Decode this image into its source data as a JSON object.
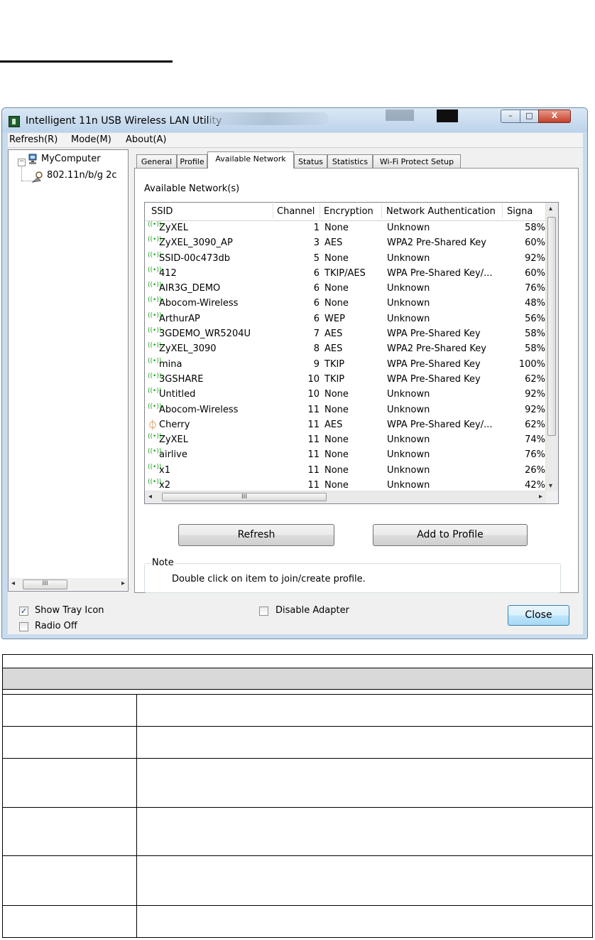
{
  "window": {
    "title": "Intelligent 11n USB Wireless LAN Utility",
    "caption_buttons": {
      "minimize": "–",
      "maximize": "□",
      "close": "X"
    }
  },
  "menu": {
    "refresh": "Refresh(R)",
    "mode": "Mode(M)",
    "about": "About(A)"
  },
  "tree": {
    "root": "MyComputer",
    "child": "802.11n/b/g 2c",
    "scroll_thumb": "III"
  },
  "tabs": [
    "General",
    "Profile",
    "Available Network",
    "Status",
    "Statistics",
    "Wi-Fi Protect Setup"
  ],
  "available_label": "Available Network(s)",
  "columns": {
    "ssid": "SSID",
    "channel": "Channel",
    "encryption": "Encryption",
    "auth": "Network Authentication",
    "signal": "Signa"
  },
  "networks": [
    {
      "ssid": "ZyXEL",
      "channel": "1",
      "encryption": "None",
      "auth": "Unknown",
      "signal": "58%",
      "icon": "wifi-signal-icon"
    },
    {
      "ssid": "ZyXEL_3090_AP",
      "channel": "3",
      "encryption": "AES",
      "auth": "WPA2 Pre-Shared Key",
      "signal": "60%",
      "icon": "wifi-signal-icon"
    },
    {
      "ssid": "SSID-00c473db",
      "channel": "5",
      "encryption": "None",
      "auth": "Unknown",
      "signal": "92%",
      "icon": "wifi-signal-icon"
    },
    {
      "ssid": "412",
      "channel": "6",
      "encryption": "TKIP/AES",
      "auth": "WPA Pre-Shared Key/...",
      "signal": "60%",
      "icon": "wifi-signal-icon"
    },
    {
      "ssid": "AIR3G_DEMO",
      "channel": "6",
      "encryption": "None",
      "auth": "Unknown",
      "signal": "76%",
      "icon": "wifi-signal-icon"
    },
    {
      "ssid": "Abocom-Wireless",
      "channel": "6",
      "encryption": "None",
      "auth": "Unknown",
      "signal": "48%",
      "icon": "wifi-signal-icon"
    },
    {
      "ssid": "ArthurAP",
      "channel": "6",
      "encryption": "WEP",
      "auth": "Unknown",
      "signal": "56%",
      "icon": "wifi-signal-icon"
    },
    {
      "ssid": "3GDEMO_WR5204U",
      "channel": "7",
      "encryption": "AES",
      "auth": "WPA Pre-Shared Key",
      "signal": "58%",
      "icon": "wifi-signal-icon"
    },
    {
      "ssid": "ZyXEL_3090",
      "channel": "8",
      "encryption": "AES",
      "auth": "WPA2 Pre-Shared Key",
      "signal": "58%",
      "icon": "wifi-signal-icon"
    },
    {
      "ssid": "mina",
      "channel": "9",
      "encryption": "TKIP",
      "auth": "WPA Pre-Shared Key",
      "signal": "100%",
      "icon": "wifi-signal-icon"
    },
    {
      "ssid": "3GSHARE",
      "channel": "10",
      "encryption": "TKIP",
      "auth": "WPA Pre-Shared Key",
      "signal": "62%",
      "icon": "wifi-signal-icon"
    },
    {
      "ssid": "Untitled",
      "channel": "10",
      "encryption": "None",
      "auth": "Unknown",
      "signal": "92%",
      "icon": "wifi-signal-icon"
    },
    {
      "ssid": "Abocom-Wireless",
      "channel": "11",
      "encryption": "None",
      "auth": "Unknown",
      "signal": "92%",
      "icon": "wifi-signal-icon"
    },
    {
      "ssid": "Cherry",
      "channel": "11",
      "encryption": "AES",
      "auth": "WPA Pre-Shared Key/...",
      "signal": "62%",
      "icon": "connected-network-icon"
    },
    {
      "ssid": "ZyXEL",
      "channel": "11",
      "encryption": "None",
      "auth": "Unknown",
      "signal": "74%",
      "icon": "wifi-signal-icon"
    },
    {
      "ssid": "airlive",
      "channel": "11",
      "encryption": "None",
      "auth": "Unknown",
      "signal": "76%",
      "icon": "wifi-signal-icon"
    },
    {
      "ssid": "x1",
      "channel": "11",
      "encryption": "None",
      "auth": "Unknown",
      "signal": "26%",
      "icon": "wifi-signal-icon"
    },
    {
      "ssid": "x2",
      "channel": "11",
      "encryption": "None",
      "auth": "Unknown",
      "signal": "42%",
      "icon": "wifi-signal-icon"
    }
  ],
  "list_hscroll_thumb": "III",
  "buttons": {
    "refresh": "Refresh",
    "add_profile": "Add to Profile",
    "close": "Close"
  },
  "note": {
    "title": "Note",
    "text": "Double click on item to join/create profile."
  },
  "options": {
    "show_tray": {
      "label": "Show Tray Icon",
      "checked": true
    },
    "radio_off": {
      "label": "Radio Off",
      "checked": false
    },
    "disable_adapter": {
      "label": "Disable Adapter",
      "checked": false
    }
  },
  "colors": {
    "signal_icon": "#19a519",
    "connected_icon": "#c86400",
    "table_header": "#d9d9d9"
  }
}
